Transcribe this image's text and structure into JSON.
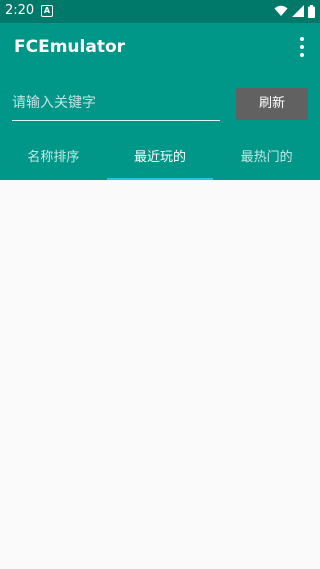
{
  "status_bar": {
    "time": "2:20",
    "notification_glyph": "A"
  },
  "app_bar": {
    "title": "FCEmulator",
    "menu_icon": "more-vert-icon"
  },
  "search": {
    "placeholder": "请输入关键字",
    "value": "",
    "refresh_label": "刷新"
  },
  "tabs": [
    {
      "label": "名称排序",
      "active": false
    },
    {
      "label": "最近玩的",
      "active": true
    },
    {
      "label": "最热门的",
      "active": false
    }
  ],
  "colors": {
    "status_bar": "#00796b",
    "primary": "#009688",
    "button": "#616161",
    "tab_indicator": "#26c6da",
    "background": "#fafafa"
  }
}
